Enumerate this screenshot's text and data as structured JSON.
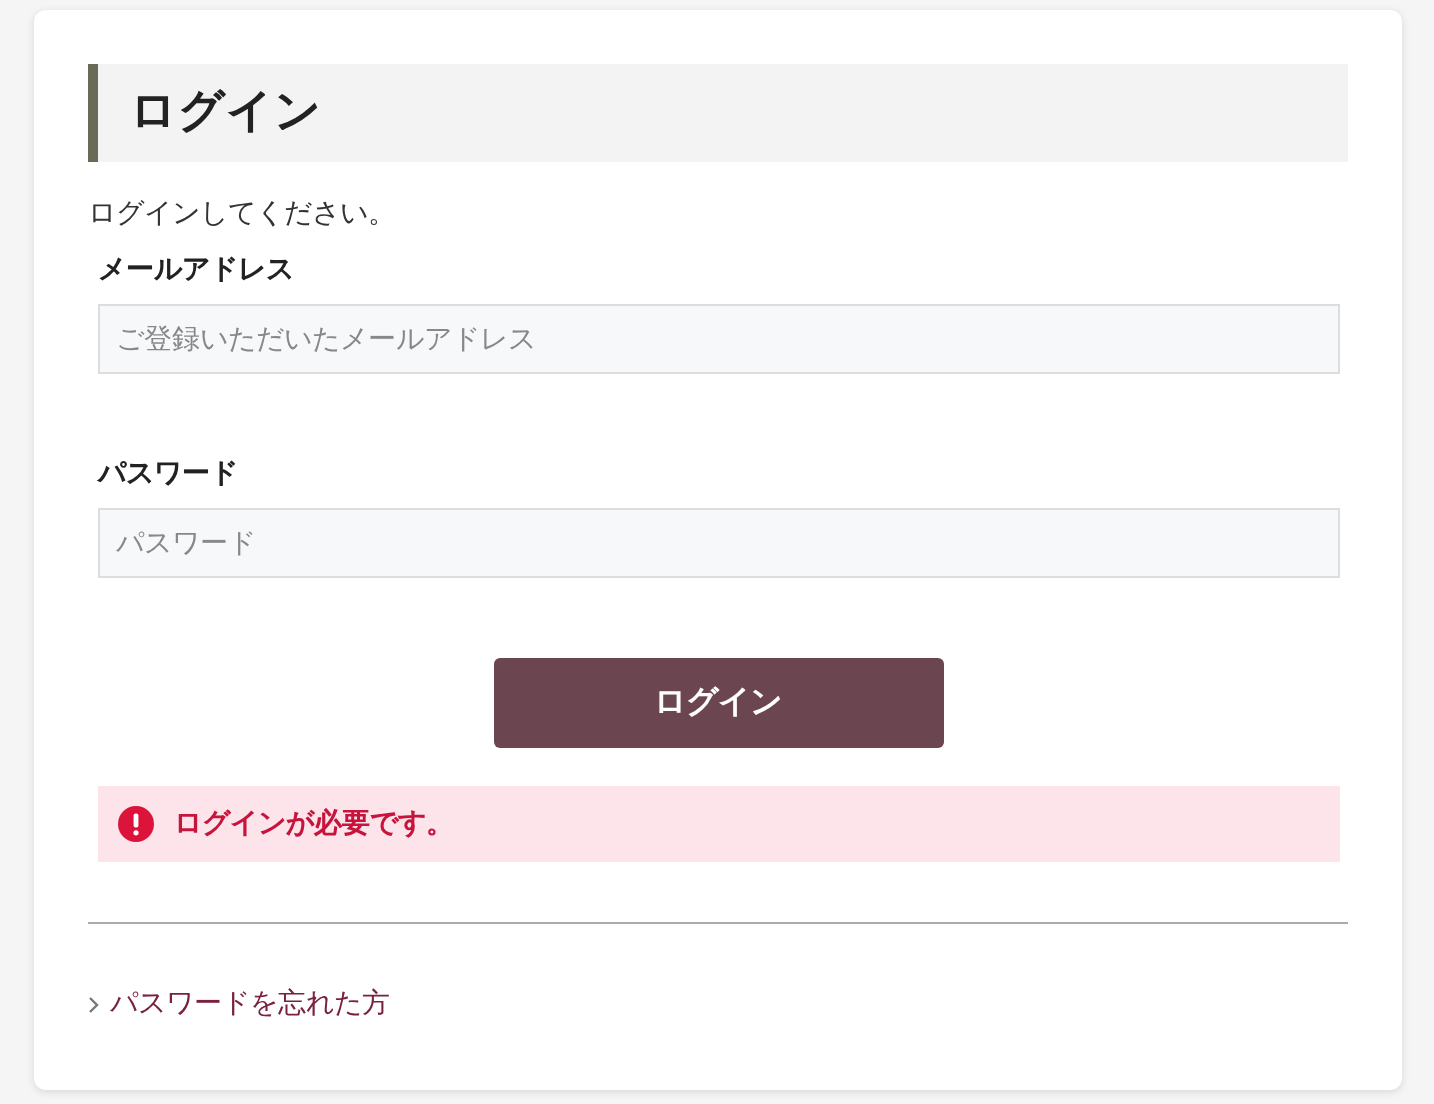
{
  "heading": "ログイン",
  "intro": "ログインしてください。",
  "fields": [
    {
      "label": "メールアドレス",
      "placeholder": "ご登録いただいたメールアドレス"
    },
    {
      "label": "パスワード",
      "placeholder": "パスワード"
    }
  ],
  "submit": "ログイン",
  "error": "ログインが必要です。",
  "link": "パスワードを忘れた方"
}
